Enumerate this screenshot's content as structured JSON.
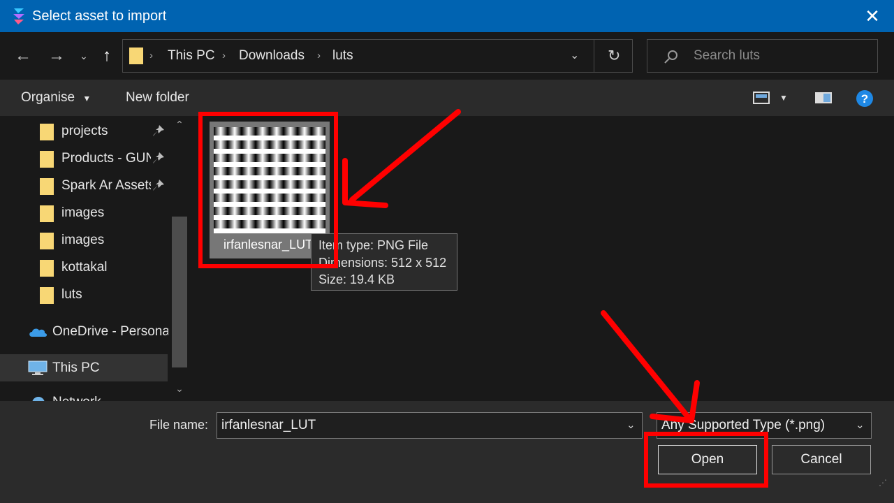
{
  "window": {
    "title": "Select asset to import"
  },
  "address": {
    "crumbs": [
      "This PC",
      "Downloads",
      "luts"
    ]
  },
  "search": {
    "placeholder": "Search luts"
  },
  "toolbar": {
    "organise": "Organise",
    "new_folder": "New folder"
  },
  "sidebar": {
    "items": [
      {
        "label": "projects",
        "pinned": true
      },
      {
        "label": "Products - GUN",
        "pinned": true
      },
      {
        "label": "Spark Ar Assets",
        "pinned": true
      },
      {
        "label": "images",
        "pinned": false
      },
      {
        "label": "images",
        "pinned": false
      },
      {
        "label": "kottakal",
        "pinned": false
      },
      {
        "label": "luts",
        "pinned": false
      }
    ],
    "onedrive": "OneDrive - Personal",
    "this_pc": "This PC",
    "network": "Network"
  },
  "file": {
    "name": "irfanlesnar_LUT"
  },
  "tooltip": {
    "type": "Item type: PNG File",
    "dimensions": "Dimensions: 512 x 512",
    "size": "Size: 19.4 KB"
  },
  "footer": {
    "file_name_label": "File name:",
    "file_name_value": "irfanlesnar_LUT",
    "file_type": "Any Supported Type (*.png)",
    "open": "Open",
    "cancel": "Cancel"
  },
  "colors": {
    "accent": "#0063b1",
    "annotation": "#ff0000",
    "folder": "#f8d775"
  }
}
